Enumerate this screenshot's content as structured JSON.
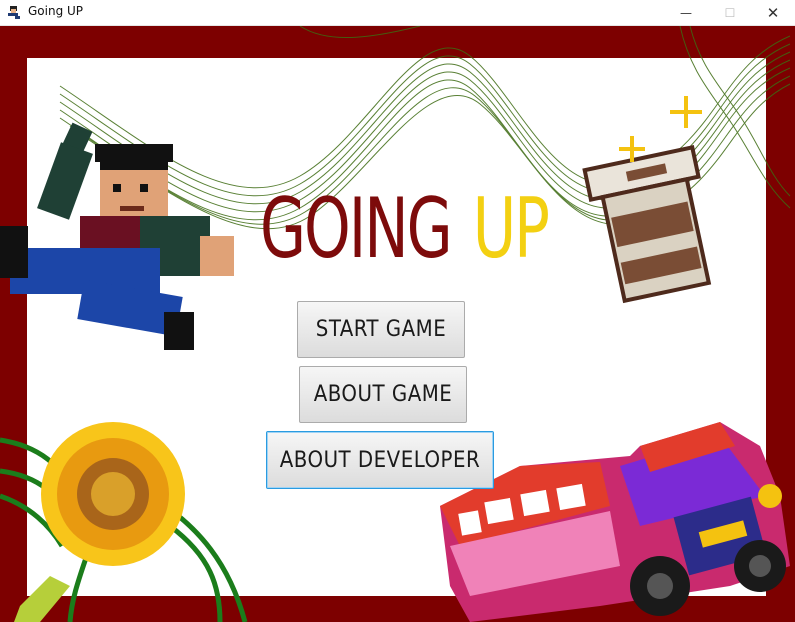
{
  "window": {
    "title": "Going UP",
    "minimize": "—",
    "maximize": "☐",
    "close": "✕"
  },
  "logo": {
    "word1": "GOING",
    "word2": "UP"
  },
  "menu": {
    "start_label": "START GAME",
    "about_game_label": "ABOUT GAME",
    "about_developer_label": "ABOUT DEVELOPER",
    "focused": "about_developer"
  },
  "colors": {
    "frame": "#7d0000",
    "logo_word1": "#7d0b0b",
    "logo_word2": "#f3d012",
    "focus_border": "#2a9be0"
  },
  "icons": [
    "app-icon",
    "pixel-boy-sprite",
    "pixel-coffee-cup-sprite",
    "pixel-sunflower-sprite",
    "jeepney-illustration"
  ]
}
